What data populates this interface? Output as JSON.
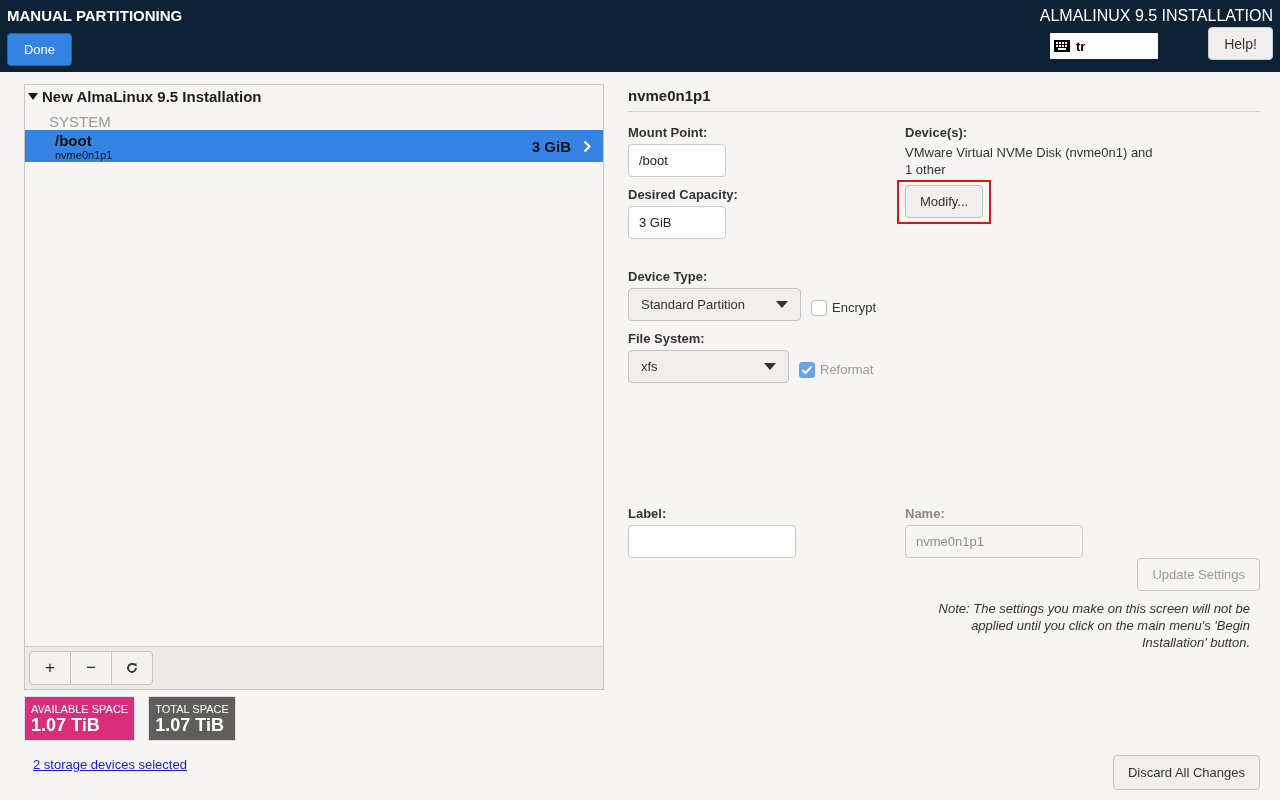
{
  "header": {
    "title": "MANUAL PARTITIONING",
    "done_button": "Done",
    "product": "ALMALINUX 9.5 INSTALLATION",
    "keyboard_layout": "tr",
    "help_button": "Help!"
  },
  "tree": {
    "root": {
      "label": "New AlmaLinux 9.5 Installation",
      "expanded": true,
      "children": [
        {
          "label": "SYSTEM",
          "children": [
            {
              "mount": "/boot",
              "device": "nvme0n1p1",
              "size": "3 GiB",
              "selected": true
            }
          ]
        }
      ]
    }
  },
  "toolbar": {
    "buttons": [
      "+",
      "−"
    ]
  },
  "space": [
    {
      "label": "AVAILABLE SPACE",
      "value": "1.07 TiB",
      "color": "#d92f7b"
    },
    {
      "label": "TOTAL SPACE",
      "value": "1.07 TiB",
      "color": "#5f5e5a"
    }
  ],
  "storage_link": "2 storage devices selected",
  "details": {
    "heading": "nvme0n1p1",
    "mount_point": {
      "label": "Mount Point:",
      "value": "/boot"
    },
    "capacity": {
      "label": "Desired Capacity:",
      "value": "3 GiB"
    },
    "devices": {
      "label": "Device(s):",
      "text": "VMware Virtual NVMe Disk (nvme0n1) and 1 other",
      "modify_button": "Modify...",
      "highlighted": true
    },
    "device_type": {
      "label": "Device Type:",
      "value": "Standard Partition",
      "encrypt": {
        "label": "Encrypt",
        "checked": false
      }
    },
    "file_system": {
      "label": "File System:",
      "value": "xfs",
      "reformat": {
        "label": "Reformat",
        "checked": true,
        "disabled": true
      }
    },
    "label_field": {
      "label": "Label:"
    },
    "name_field": {
      "label": "Name:",
      "value": "nvme0n1p1",
      "disabled": true
    },
    "update_button": {
      "label": "Update Settings",
      "disabled": true
    },
    "note": "Note:  The settings you make on this screen will not be applied until you click on the main menu's 'Begin Installation' button.",
    "discard_button": "Discard All Changes"
  }
}
